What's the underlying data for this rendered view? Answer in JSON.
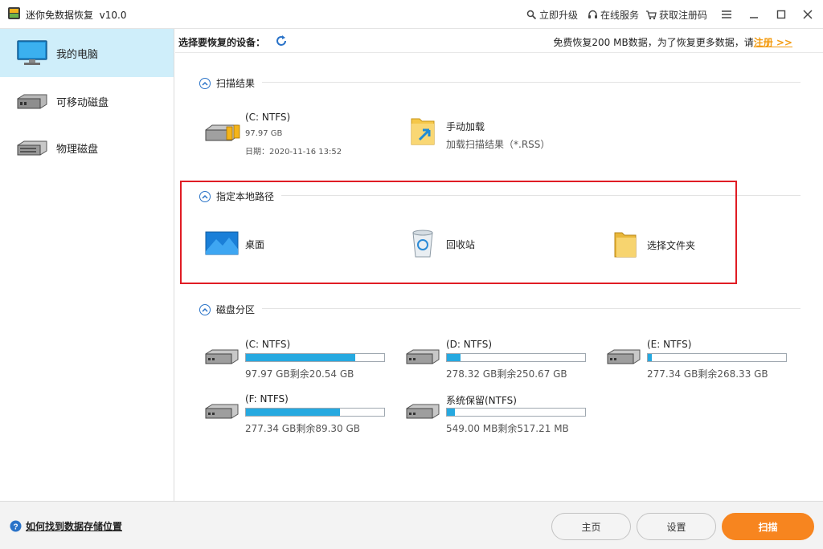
{
  "app": {
    "title": "迷你免数据恢复",
    "version": "v10.0"
  },
  "titlebar": {
    "upgrade": "立即升级",
    "service": "在线服务",
    "register": "获取注册码"
  },
  "sidebar": {
    "items": [
      {
        "label": "我的电脑",
        "icon": "monitor-icon",
        "active": true
      },
      {
        "label": "可移动磁盘",
        "icon": "removable-disk-icon",
        "active": false
      },
      {
        "label": "物理磁盘",
        "icon": "physical-disk-icon",
        "active": false
      }
    ]
  },
  "topbar": {
    "device_label": "选择要恢复的设备：",
    "promo_text": "免费恢复200 MB数据，为了恢复更多数据，请",
    "promo_link": "注册 >>"
  },
  "scan_results": {
    "title": "扫描结果",
    "drive": {
      "name": "(C: NTFS)",
      "size": "97.97 GB",
      "date": "日期：2020-11-16 13:52"
    },
    "manual": {
      "name": "手动加载",
      "desc": "加载扫描结果（*.RSS）"
    }
  },
  "local_path": {
    "title": "指定本地路径",
    "items": [
      {
        "label": "桌面",
        "icon": "desktop-icon"
      },
      {
        "label": "回收站",
        "icon": "recycle-bin-icon"
      },
      {
        "label": "选择文件夹",
        "icon": "folder-icon"
      }
    ]
  },
  "partitions": {
    "title": "磁盘分区",
    "items": [
      {
        "name": "(C: NTFS)",
        "info": "97.97 GB剩余20.54 GB",
        "used_fraction": 0.79
      },
      {
        "name": "(D: NTFS)",
        "info": "278.32 GB剩余250.67 GB",
        "used_fraction": 0.1
      },
      {
        "name": "(E: NTFS)",
        "info": "277.34 GB剩余268.33 GB",
        "used_fraction": 0.03
      },
      {
        "name": "(F: NTFS)",
        "info": "277.34 GB剩余89.30 GB",
        "used_fraction": 0.68
      },
      {
        "name": "系统保留(NTFS)",
        "info": "549.00 MB剩余517.21 MB",
        "used_fraction": 0.06
      }
    ]
  },
  "footer": {
    "help": "如何找到数据存储位置",
    "home": "主页",
    "settings": "设置",
    "scan": "扫描"
  },
  "colors": {
    "accent": "#26a9e0",
    "scan_button": "#f7851f",
    "highlight_box": "#e01c24",
    "sidebar_active": "#cfeefa"
  }
}
